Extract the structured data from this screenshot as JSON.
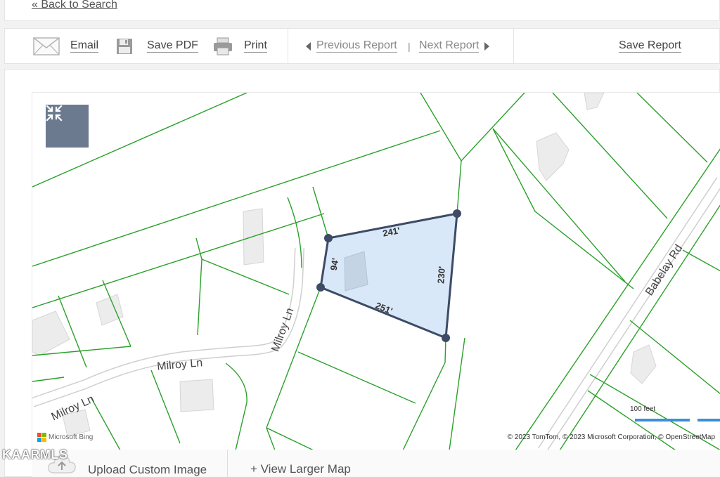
{
  "header": {
    "back_label": "« Back to Search"
  },
  "toolbar": {
    "email_label": "Email",
    "save_pdf_label": "Save PDF",
    "print_label": "Print",
    "previous_label": "Previous Report",
    "separator": "|",
    "next_label": "Next Report",
    "save_report_label": "Save Report"
  },
  "map": {
    "streets": [
      "Milroy Ln",
      "Milroy Ln",
      "Milroy Ln",
      "Babelay Rd"
    ],
    "dimensions": [
      "241'",
      "94'",
      "230'",
      "251'"
    ],
    "scale_label": "100 feet",
    "attribution": "© 2023 TomTom, © 2023 Microsoft Corporation, © OpenStreetMap",
    "provider": "Microsoft Bing",
    "colors": {
      "parcel_lines": "#2aa12a",
      "selected_fill": "#d6e6f7",
      "selected_stroke": "#3d4b66",
      "scale_bar": "#3b8fd9"
    },
    "icons": {
      "collapse": "collapse-arrows-icon"
    }
  },
  "bottom": {
    "upload_label": "Upload Custom Image",
    "larger_map_label": "+ View Larger Map"
  },
  "watermark": "KAARMLS"
}
